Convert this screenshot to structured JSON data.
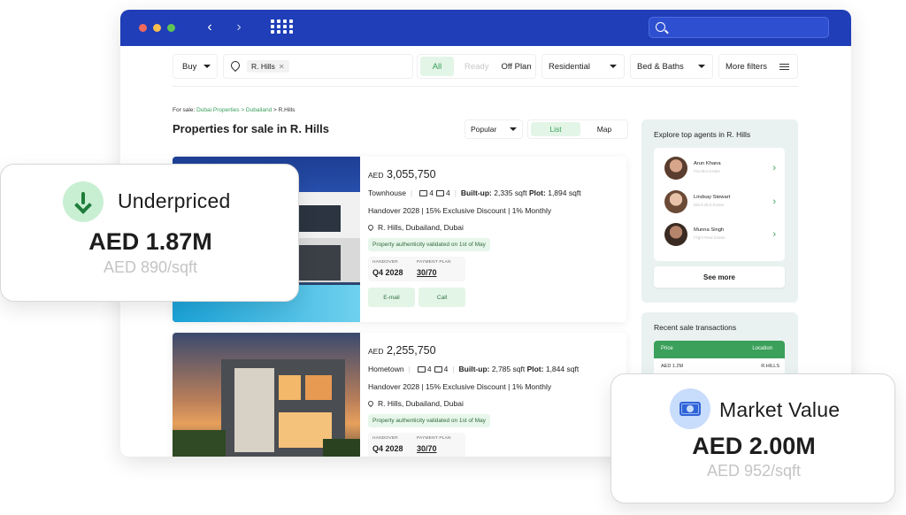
{
  "filters": {
    "type": "Buy",
    "location_chip": "R. Hills",
    "status_all": "All",
    "status_ready": "Ready",
    "status_offplan": "Off Plan",
    "category": "Residential",
    "beds": "Bed & Baths",
    "more": "More filters"
  },
  "breadcrumb": {
    "prefix": "For sale:",
    "trail": "Dubai Properties > Dubailand",
    "current": "> R.Hills"
  },
  "page": {
    "title": "Properties for sale in R. Hills",
    "sort": "Popular",
    "view_list": "List",
    "view_map": "Map"
  },
  "listings": [
    {
      "currency": "AED",
      "price": "3,055,750",
      "type": "Townhouse",
      "beds": "4",
      "baths": "4",
      "builtup_label": "Built-up:",
      "builtup": "2,335 sqft",
      "plot_label": "Plot:",
      "plot": "1,894 sqft",
      "handover_line": "Handover 2028 | 15% Exclusive Discount | 1% Monthly",
      "address": "R. Hills, Dubailand, Dubai",
      "validated": "Property authenticity validated on 1st of May",
      "handover_label": "HANDOVER",
      "handover": "Q4 2028",
      "plan_label": "PAYMENT PLAN",
      "plan": "30/70",
      "email": "E-mail",
      "call": "Call"
    },
    {
      "currency": "AED",
      "price": "2,255,750",
      "type": "Hometown",
      "beds": "4",
      "baths": "4",
      "builtup_label": "Built-up:",
      "builtup": "2,785 sqft",
      "plot_label": "Plot:",
      "plot": "1,844 sqft",
      "handover_line": "Handover 2028 | 15% Exclusive Discount | 1% Monthly",
      "address": "R. Hills, Dubailand, Dubai",
      "validated": "Property authenticity validated on 1st of May",
      "handover_label": "HANDOVER",
      "handover": "Q4 2028",
      "plan_label": "PAYMENT PLAN",
      "plan": "30/70"
    }
  ],
  "agents": {
    "title": "Explore top agents in R. Hills",
    "items": [
      {
        "name": "Arun Khana",
        "sub": "Pixelbot Estate"
      },
      {
        "name": "Lindsay Stewart",
        "sub": "Black Bird Estate"
      },
      {
        "name": "Munna Singh",
        "sub": "Flight Real Estate"
      }
    ],
    "see_more": "See more"
  },
  "transactions": {
    "title": "Recent sale transactions",
    "col_price": "Price",
    "col_location": "Location",
    "rows": [
      {
        "price": "AED 1.2M",
        "location": "R.HILLS"
      }
    ]
  },
  "underpriced": {
    "label": "Underpriced",
    "value": "AED 1.87M",
    "per_sqft": "AED 890/sqft"
  },
  "market_value": {
    "label": "Market Value",
    "value": "AED 2.00M",
    "per_sqft": "AED 952/sqft"
  },
  "colors": {
    "titlebar": "#1f3eb7",
    "accent_green": "#3aa05a",
    "chip_green_bg": "#e3f5e7",
    "panel_bg": "#e9f2f1"
  },
  "icons": [
    "search-icon",
    "back-icon",
    "forward-icon",
    "apps-grid-icon",
    "location-pin-icon",
    "filter-sliders-icon",
    "bed-icon",
    "bath-icon",
    "down-arrow-icon",
    "cash-icon",
    "chevron-right-icon"
  ]
}
